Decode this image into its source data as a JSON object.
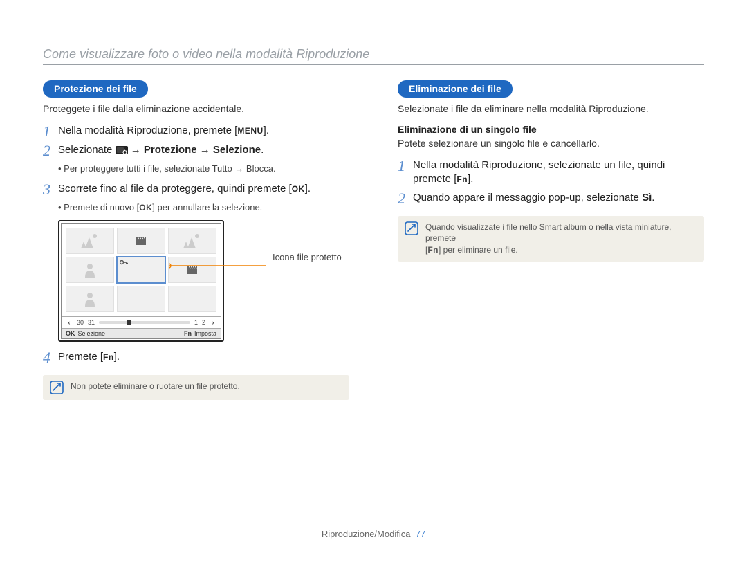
{
  "chapter": "Come visualizzare foto o video nella modalità Riproduzione",
  "left": {
    "pill": "Protezione dei file",
    "intro": "Proteggete i file dalla eliminazione accidentale.",
    "step1": {
      "pre": "Nella modalità Riproduzione, premete [",
      "key": "MENU",
      "post": "]."
    },
    "step2": {
      "pre": "Selezionate ",
      "bold": " → Protezione → Selezione",
      "post": "."
    },
    "bullet2_pre": "Per proteggere tutti i file, selezionate ",
    "bullet2_bold": "Tutto → Blocca",
    "bullet2_post": ".",
    "step3": {
      "pre": "Scorrete fino al file da proteggere, quindi premete [",
      "key": "OK",
      "post": "]."
    },
    "bullet3_pre": "Premete di nuovo [",
    "bullet3_key": "OK",
    "bullet3_post": "] per annullare la selezione.",
    "callout": "Icona file protetto",
    "screen": {
      "timeline_nums_left": [
        "30",
        "31"
      ],
      "timeline_nums_right": [
        "1",
        "2"
      ],
      "status_left_key": "OK",
      "status_left_label": "Selezione",
      "status_right_key": "Fn",
      "status_right_label": "Imposta"
    },
    "step4": {
      "pre": "Premete [",
      "key": "Fn",
      "post": "]."
    },
    "tip": "Non potete eliminare o ruotare un file protetto."
  },
  "right": {
    "pill": "Eliminazione dei file",
    "intro": "Selezionate i file da eliminare nella modalità Riproduzione.",
    "sub": "Eliminazione di un singolo file",
    "sub_intro": "Potete selezionare un singolo file e cancellarlo.",
    "step1_line1": "Nella modalità Riproduzione, selezionate un file, quindi",
    "step1_line2_pre": "premete [",
    "step1_line2_key": "Fn",
    "step1_line2_post": "].",
    "step2_pre": "Quando appare il messaggio pop-up, selezionate ",
    "step2_bold": "Sì",
    "step2_post": ".",
    "tip_line1": "Quando visualizzate i file nello Smart album o nella vista miniature, premete",
    "tip_line2_pre": "[",
    "tip_line2_key": "Fn",
    "tip_line2_post": "] per eliminare un file."
  },
  "footer": {
    "label": "Riproduzione/Modifica",
    "page": "77"
  }
}
